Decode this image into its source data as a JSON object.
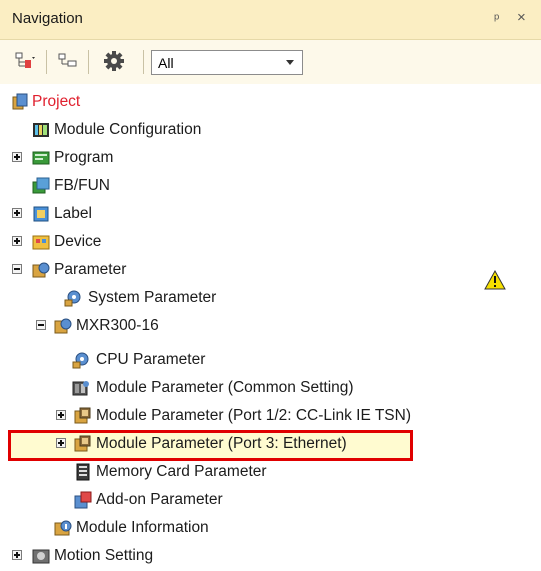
{
  "window": {
    "title": "Navigation",
    "pin_glyph": "ᵖ",
    "close_glyph": "×"
  },
  "toolbar": {
    "buttons": [
      {
        "icon": "expand-tree-icon"
      },
      {
        "icon": "collapse-tree-icon"
      },
      {
        "icon": "gear-icon"
      }
    ],
    "filter": {
      "selected": "All"
    }
  },
  "tree": {
    "items": [
      {
        "label": "Project",
        "icon": "project-icon",
        "level": 0,
        "expander": "none"
      },
      {
        "label": "Module Configuration",
        "icon": "module-configuration-icon",
        "level": 1,
        "expander": "none"
      },
      {
        "label": "Program",
        "icon": "program-icon",
        "level": 1,
        "expander": "plus"
      },
      {
        "label": "FB/FUN",
        "icon": "fb-fun-icon",
        "level": 1,
        "expander": "none"
      },
      {
        "label": "Label",
        "icon": "label-icon",
        "level": 1,
        "expander": "plus"
      },
      {
        "label": "Device",
        "icon": "device-icon",
        "level": 1,
        "expander": "plus"
      },
      {
        "label": "Parameter",
        "icon": "parameter-icon",
        "level": 1,
        "expander": "minus",
        "warning": true
      },
      {
        "label": "System Parameter",
        "icon": "system-parameter-icon",
        "level": 2,
        "expander": "none"
      },
      {
        "label": "MXR300-16",
        "icon": "cpu-module-icon",
        "level": 2,
        "expander": "minus"
      },
      {
        "label": "CPU Parameter",
        "icon": "cpu-parameter-icon",
        "level": 3,
        "expander": "none",
        "selected": true
      },
      {
        "label": "Module Parameter (Common Setting)",
        "icon": "module-parameter-icon",
        "level": 3,
        "expander": "none"
      },
      {
        "label": "Module Parameter (Port 1/2: CC-Link IE TSN)",
        "icon": "network-module-icon",
        "level": 3,
        "expander": "plus"
      },
      {
        "label": "Module Parameter (Port 3: Ethernet)",
        "icon": "network-module-icon",
        "level": 3,
        "expander": "plus"
      },
      {
        "label": "Memory Card Parameter",
        "icon": "memory-card-icon",
        "level": 3,
        "expander": "none"
      },
      {
        "label": "Add-on Parameter",
        "icon": "add-on-icon",
        "level": 3,
        "expander": "none"
      },
      {
        "label": "Module Information",
        "icon": "module-information-icon",
        "level": 2,
        "expander": "none"
      },
      {
        "label": "Motion Setting",
        "icon": "motion-setting-icon",
        "level": 1,
        "expander": "plus"
      }
    ]
  },
  "colors": {
    "title_bg": "#fbeec3",
    "toolbar_bg": "#fdf9ea",
    "project_label": "#e0202e",
    "selection_bg": "#fffbd0",
    "selection_border": "#e00000",
    "warning": "#f6e000"
  }
}
